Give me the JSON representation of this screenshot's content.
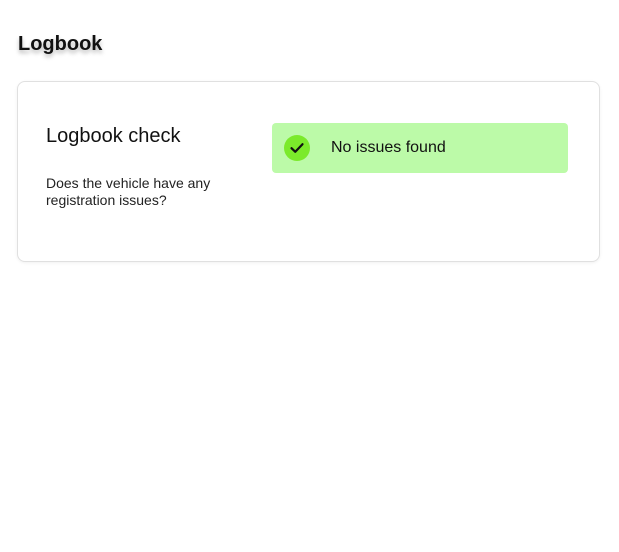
{
  "page": {
    "title": "Logbook"
  },
  "logbook_check": {
    "heading": "Logbook check",
    "question": "Does the vehicle have any registration issues?",
    "status": {
      "label": "No issues found",
      "icon": "check-circle-icon",
      "banner_color": "#bcfaa8",
      "icon_color": "#7bea2b"
    }
  }
}
